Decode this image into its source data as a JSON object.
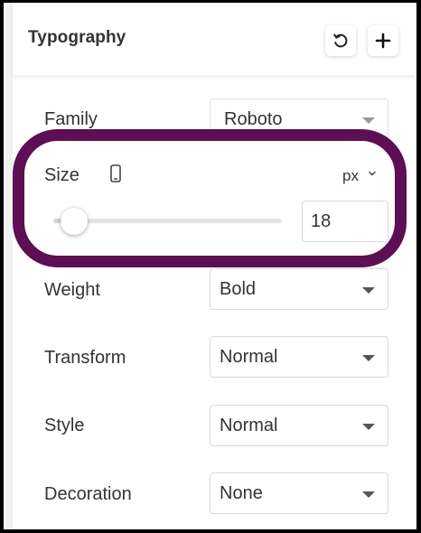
{
  "header": {
    "title": "Typography",
    "reset_icon": "reset-icon",
    "add_icon": "plus-icon"
  },
  "family": {
    "label": "Family",
    "value": "Roboto"
  },
  "size": {
    "label": "Size",
    "device_icon": "mobile-device-icon",
    "unit": "px",
    "value": "18",
    "slider_fraction": 0.09
  },
  "weight": {
    "label": "Weight",
    "value": "Bold"
  },
  "transform": {
    "label": "Transform",
    "value": "Normal"
  },
  "style": {
    "label": "Style",
    "value": "Normal"
  },
  "decoration": {
    "label": "Decoration",
    "value": "None"
  },
  "colors": {
    "highlight": "#5e0e52",
    "text": "#333333",
    "border": "#d9d9d9"
  }
}
